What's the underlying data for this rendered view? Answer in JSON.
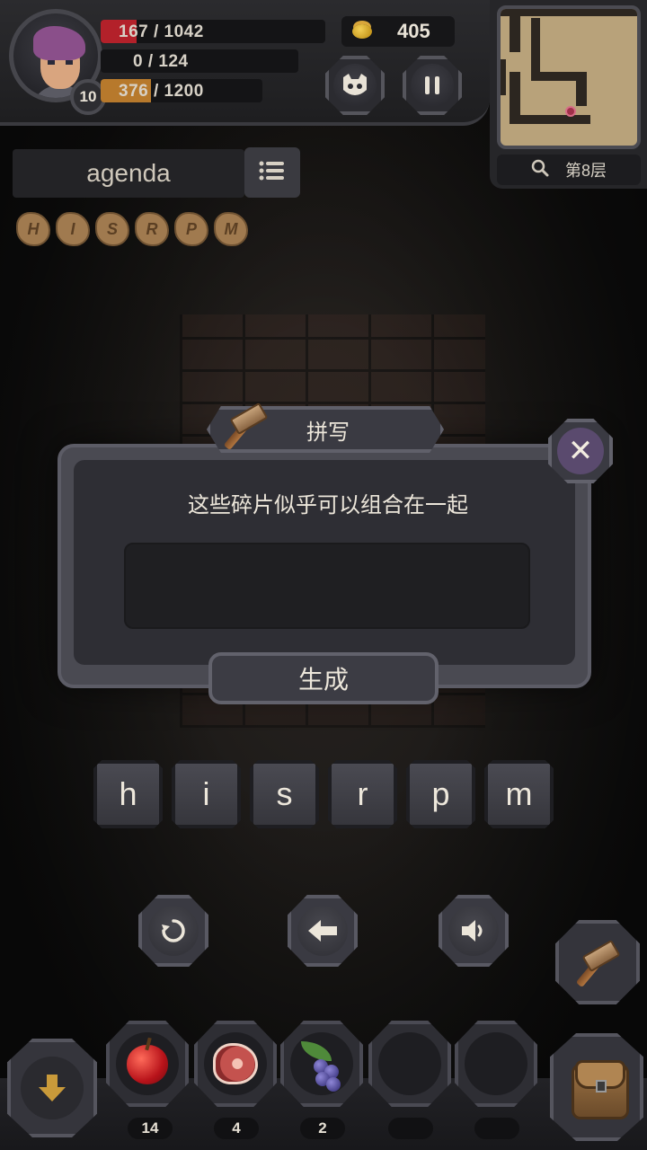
{
  "player": {
    "level": "10",
    "hp": "167 / 1042",
    "hp_fraction": 0.16,
    "mana": "0 / 124",
    "mana_fraction": 0.0,
    "xp": "376 / 1200",
    "xp_fraction": 0.31
  },
  "gold": "405",
  "minimap": {
    "floor": "第8层"
  },
  "current_word": "agenda",
  "collected_shards": [
    "H",
    "I",
    "S",
    "R",
    "P",
    "M"
  ],
  "dialog": {
    "title": "拼写",
    "message": "这些碎片似乎可以组合在一起",
    "answer_value": "",
    "generate_label": "生成",
    "close_symbol": "✕"
  },
  "letter_tiles": [
    "h",
    "i",
    "s",
    "r",
    "p",
    "m"
  ],
  "controls": {
    "reset_symbol": "↻",
    "backspace_symbol": "⬅",
    "sound_symbol": "🔈"
  },
  "inventory": [
    {
      "item": "apple",
      "count": "14"
    },
    {
      "item": "meat",
      "count": "4"
    },
    {
      "item": "berries",
      "count": "2"
    },
    {
      "item": "empty",
      "count": ""
    },
    {
      "item": "empty",
      "count": ""
    }
  ],
  "drop_symbol": "⬇",
  "colors": {
    "hp_fill": "#b3212a",
    "xp_fill": "#b7792c",
    "panel": "#2e2e34",
    "accent_purple": "#5a4a6e"
  },
  "icons": {
    "pet": "pet-face-icon",
    "pause": "pause-icon",
    "search": "magnifier-icon",
    "list": "list-icon",
    "craft": "hammer-icon",
    "bag": "backpack-icon"
  }
}
